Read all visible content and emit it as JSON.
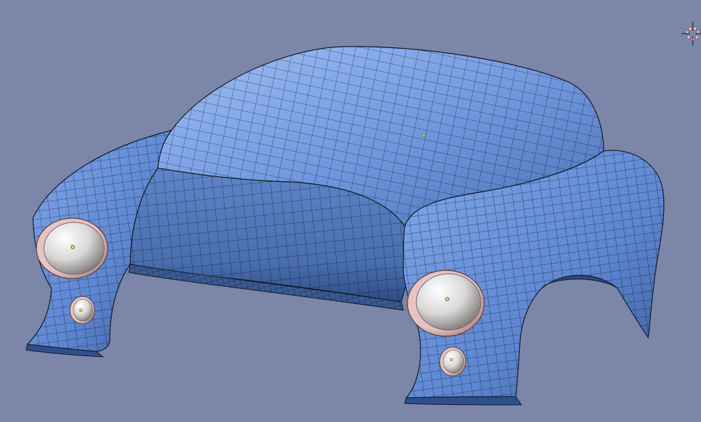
{
  "viewport": {
    "background": "#7b86a8",
    "object": "car-body-mesh"
  },
  "colors": {
    "mesh_fill_light": "#8fb1ea",
    "mesh_fill_mid": "#5f87d3",
    "mesh_fill_dark": "#3f5f9e",
    "wire": "#101820",
    "chrome_light": "#f2f2f2",
    "chrome_dark": "#8e8a8a",
    "rim": "#d6a5a5",
    "cursor_red": "#c83030"
  },
  "icons": {
    "cursor": "3d-cursor-icon",
    "headlight": "headlight-icon",
    "foglight": "foglight-icon"
  }
}
